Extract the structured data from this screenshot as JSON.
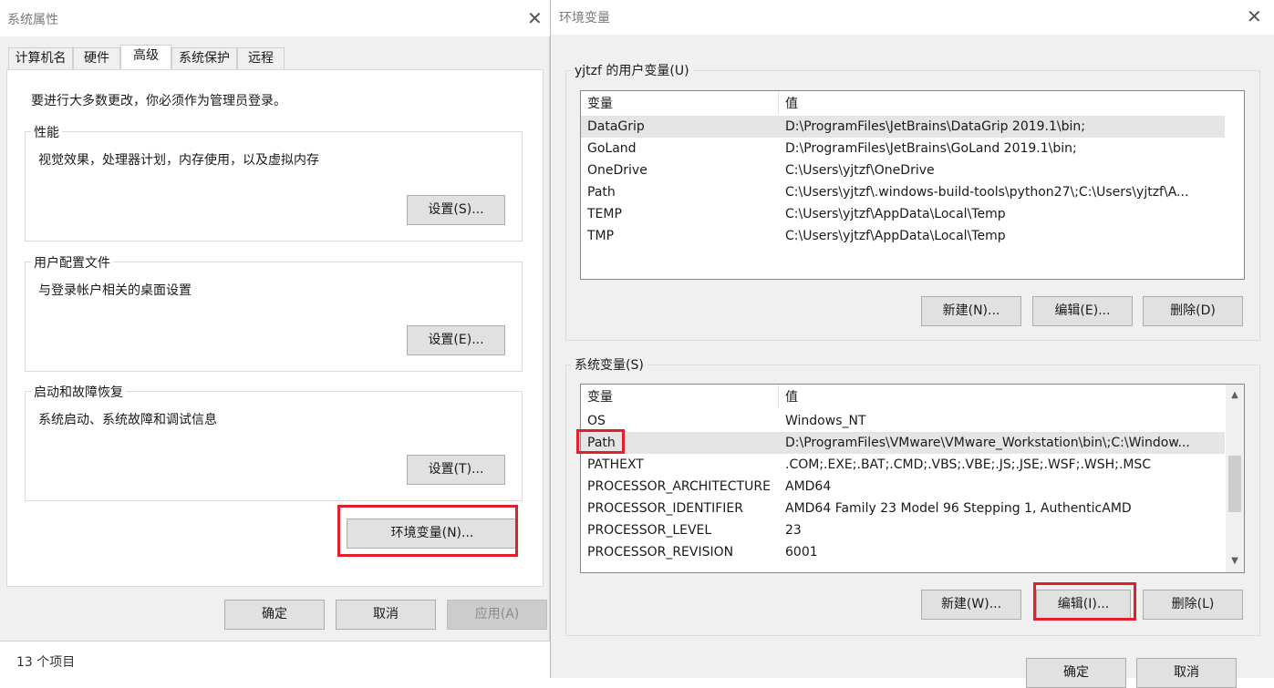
{
  "sysprops": {
    "title": "系统属性",
    "tabs": [
      "计算机名",
      "硬件",
      "高级",
      "系统保护",
      "远程"
    ],
    "admin_note": "要进行大多数更改，你必须作为管理员登录。",
    "performance": {
      "label": "性能",
      "desc": "视觉效果，处理器计划，内存使用，以及虚拟内存",
      "button": "设置(S)..."
    },
    "profiles": {
      "label": "用户配置文件",
      "desc": "与登录帐户相关的桌面设置",
      "button": "设置(E)..."
    },
    "startup": {
      "label": "启动和故障恢复",
      "desc": "系统启动、系统故障和调试信息",
      "button": "设置(T)..."
    },
    "env_button": "环境变量(N)...",
    "ok": "确定",
    "cancel": "取消",
    "apply": "应用(A)"
  },
  "envvars": {
    "title": "环境变量",
    "user_section_label": "yjtzf 的用户变量(U)",
    "system_section_label": "系统变量(S)",
    "col_var": "变量",
    "col_val": "值",
    "user_rows": [
      {
        "name": "DataGrip",
        "value": "D:\\ProgramFiles\\JetBrains\\DataGrip 2019.1\\bin;"
      },
      {
        "name": "GoLand",
        "value": "D:\\ProgramFiles\\JetBrains\\GoLand 2019.1\\bin;"
      },
      {
        "name": "OneDrive",
        "value": "C:\\Users\\yjtzf\\OneDrive"
      },
      {
        "name": "Path",
        "value": "C:\\Users\\yjtzf\\.windows-build-tools\\python27\\;C:\\Users\\yjtzf\\A..."
      },
      {
        "name": "TEMP",
        "value": "C:\\Users\\yjtzf\\AppData\\Local\\Temp"
      },
      {
        "name": "TMP",
        "value": "C:\\Users\\yjtzf\\AppData\\Local\\Temp"
      }
    ],
    "user_buttons": {
      "new": "新建(N)...",
      "edit": "编辑(E)...",
      "delete": "删除(D)"
    },
    "system_rows": [
      {
        "name": "OS",
        "value": "Windows_NT"
      },
      {
        "name": "Path",
        "value": "D:\\ProgramFiles\\VMware\\VMware_Workstation\\bin\\;C:\\Window..."
      },
      {
        "name": "PATHEXT",
        "value": ".COM;.EXE;.BAT;.CMD;.VBS;.VBE;.JS;.JSE;.WSF;.WSH;.MSC"
      },
      {
        "name": "PROCESSOR_ARCHITECTURE",
        "value": "AMD64"
      },
      {
        "name": "PROCESSOR_IDENTIFIER",
        "value": "AMD64 Family 23 Model 96 Stepping 1, AuthenticAMD"
      },
      {
        "name": "PROCESSOR_LEVEL",
        "value": "23"
      },
      {
        "name": "PROCESSOR_REVISION",
        "value": "6001"
      }
    ],
    "system_buttons": {
      "new": "新建(W)...",
      "edit": "编辑(I)...",
      "delete": "删除(L)"
    },
    "ok": "确定",
    "cancel": "取消"
  },
  "statusbar": {
    "item_count": "13 个项目"
  },
  "colors": {
    "highlight_red": "#e0202a",
    "selection": "#e5e5e5"
  }
}
